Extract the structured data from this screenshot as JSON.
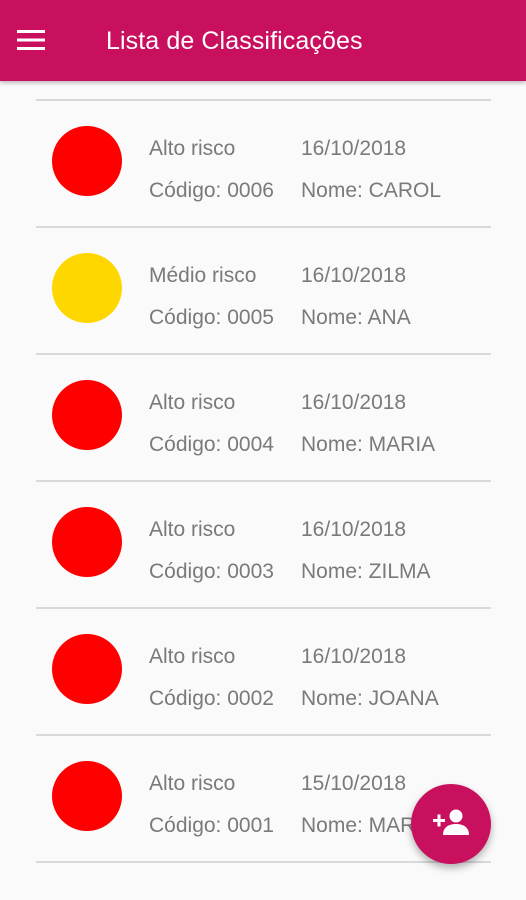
{
  "appbar": {
    "title": "Lista de Classificações",
    "menu_icon": "hamburger-menu-icon",
    "color": "#c9105f"
  },
  "colors": {
    "high_risk": "#ff0000",
    "medium_risk": "#ffd700",
    "text": "#7a7a7a",
    "divider": "#d9d9d9"
  },
  "items": [
    {
      "risk": "Alto risco",
      "date": "16/10/2018",
      "code": "Código: 0006",
      "name": "Nome: CAROL",
      "color": "#ff0000"
    },
    {
      "risk": "Médio risco",
      "date": "16/10/2018",
      "code": "Código: 0005",
      "name": "Nome: ANA",
      "color": "#ffd700"
    },
    {
      "risk": "Alto risco",
      "date": "16/10/2018",
      "code": "Código: 0004",
      "name": "Nome: MARIA",
      "color": "#ff0000"
    },
    {
      "risk": "Alto risco",
      "date": "16/10/2018",
      "code": "Código: 0003",
      "name": "Nome: ZILMA",
      "color": "#ff0000"
    },
    {
      "risk": "Alto risco",
      "date": "16/10/2018",
      "code": "Código: 0002",
      "name": "Nome: JOANA",
      "color": "#ff0000"
    },
    {
      "risk": "Alto risco",
      "date": "15/10/2018",
      "code": "Código: 0001",
      "name": "Nome: MARIA",
      "color": "#ff0000"
    }
  ],
  "fab": {
    "icon": "add-person-icon"
  }
}
